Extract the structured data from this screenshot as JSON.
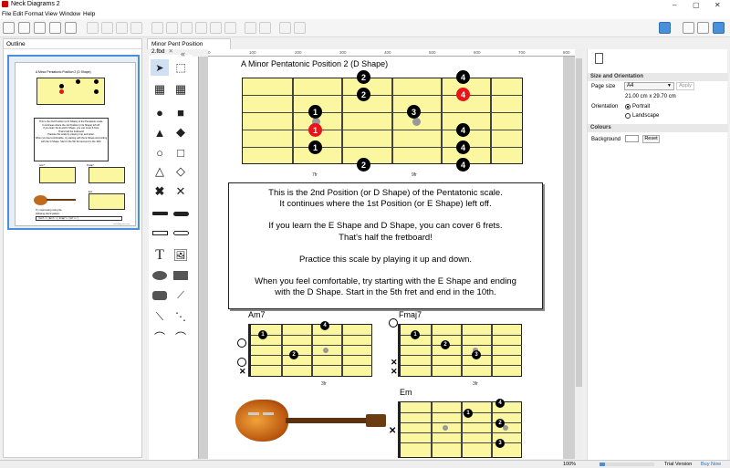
{
  "window": {
    "title": "Neck Diagrams 2"
  },
  "menu": [
    "File",
    "Edit",
    "Format",
    "View",
    "Window",
    "Help"
  ],
  "outline": {
    "title": "Outline"
  },
  "thumbnail": {
    "title": "A Minor Pentatonic Position 2 (D Shape)",
    "p1": "This is the 2nd Position (or D Shape) of the Pentatonic scale.",
    "p2": "It continues where the 1st Position (or E Shape) left off.",
    "p3": "If you learn the E and D Shape, you can cover 6 frets.",
    "p4": "That's half the fretboard!",
    "p5": "Practise this scale by playing it up and down.",
    "p6": "When you feel comfortable, try starting with the E Shape and ending",
    "p7": "with the D Shape. Start in the 5th fret and end in the 10th.",
    "chord1": "Am7",
    "chord2": "Fmaj7",
    "chord3": "Em",
    "note1": "Try improvising using the",
    "note2": "following chord pattern:",
    "pattern": "| Am7 / / / | Em7 / / / | Fmaj7 / / / | E7 / / / |",
    "footer": "neckdiagrams.com"
  },
  "document": {
    "tab": "Minor Pent Position 2.fbd",
    "title": "A Minor Pentatonic Position 2  (D Shape)",
    "fret_labels": [
      "7fr",
      "9fr"
    ],
    "text": [
      "This is the 2nd Position (or D Shape) of the Pentatonic scale.",
      "It continues where the 1st Position (or E Shape) left off.",
      "",
      "If you learn the E Shape and D Shape, you can cover 6 frets.",
      "That's half the fretboard!",
      "",
      "Practice this scale by playing it up and down.",
      "",
      "When you feel comfortable, try starting with the E Shape and ending",
      "with the D Shape. Start in the 5th fret and end in the 10th."
    ],
    "chord_am7": {
      "name": "Am7",
      "fret": "3fr"
    },
    "chord_fmaj7": {
      "name": "Fmaj7",
      "fret": "3fr"
    },
    "chord_em": {
      "name": "Em"
    }
  },
  "ruler": [
    "0",
    "100",
    "200",
    "300",
    "400",
    "500",
    "600",
    "700",
    "800"
  ],
  "properties": {
    "size_header": "Size and Orientation",
    "page_size_label": "Page size",
    "page_size_value": "A4",
    "apply": "Apply",
    "dimensions": "21.00 cm x 29.70 cm",
    "orientation_label": "Orientation",
    "portrait": "Portrait",
    "landscape": "Landscape",
    "colours_header": "Colours",
    "background_label": "Background",
    "reset": "Reset"
  },
  "status": {
    "zoom": "100%",
    "trial": "Trial Version",
    "buy": "Buy Now"
  },
  "colors": {
    "accent": "#4a90d9",
    "fretboard": "#fbf6a0",
    "root": "#e8141a"
  }
}
